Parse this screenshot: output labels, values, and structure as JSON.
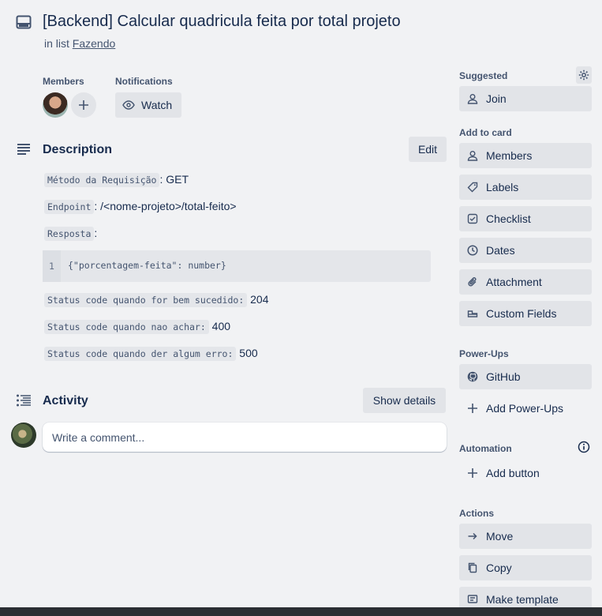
{
  "card": {
    "title": "[Backend] Calcular quadricula feita por total projeto",
    "list_prefix": "in list",
    "list_name": "Fazendo"
  },
  "members": {
    "label": "Members"
  },
  "notifications": {
    "label": "Notifications",
    "watch_label": "Watch"
  },
  "description": {
    "title": "Description",
    "edit_label": "Edit",
    "lines": [
      {
        "code": "Método da Requisição",
        "text": ": GET"
      },
      {
        "code": "Endpoint",
        "text": ": /<nome-projeto>/total-feito>"
      },
      {
        "code": "Resposta",
        "text": ":"
      }
    ],
    "code_block": {
      "line_number": "1",
      "content": "{\"porcentagem-feita\": number}"
    },
    "status_lines": [
      {
        "code": "Status code quando for bem sucedido:",
        "text": " 204"
      },
      {
        "code": "Status code quando nao achar:",
        "text": " 400"
      },
      {
        "code": "Status code quando der algum erro:",
        "text": " 500"
      }
    ]
  },
  "activity": {
    "title": "Activity",
    "show_details_label": "Show details",
    "comment_placeholder": "Write a comment..."
  },
  "sidebar": {
    "suggested_label": "Suggested",
    "join_label": "Join",
    "add_to_card_label": "Add to card",
    "add_to_card": [
      {
        "label": "Members",
        "icon": "person-icon"
      },
      {
        "label": "Labels",
        "icon": "tag-icon"
      },
      {
        "label": "Checklist",
        "icon": "checkbox-icon"
      },
      {
        "label": "Dates",
        "icon": "clock-icon"
      },
      {
        "label": "Attachment",
        "icon": "paperclip-icon"
      },
      {
        "label": "Custom Fields",
        "icon": "fields-icon"
      }
    ],
    "powerups_label": "Power-Ups",
    "github_label": "GitHub",
    "add_powerups_label": "Add Power-Ups",
    "automation_label": "Automation",
    "add_button_label": "Add button",
    "actions_label": "Actions",
    "actions": [
      {
        "label": "Move",
        "icon": "arrow-right-icon"
      },
      {
        "label": "Copy",
        "icon": "copy-icon"
      },
      {
        "label": "Make template",
        "icon": "template-icon"
      }
    ]
  },
  "colors": {
    "background": "#f1f2f4",
    "button": "#e2e4e8",
    "text": "#172b4d",
    "subtle": "#44546f"
  }
}
